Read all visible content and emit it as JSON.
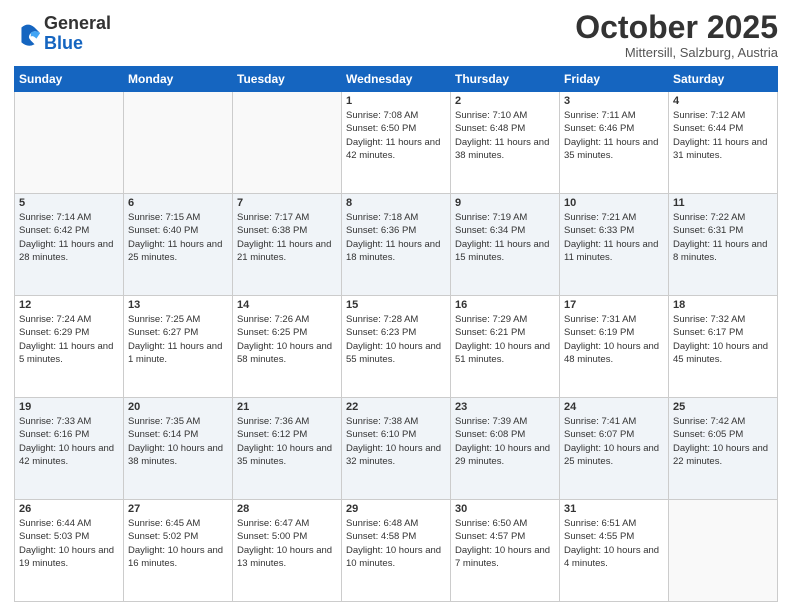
{
  "logo": {
    "general": "General",
    "blue": "Blue"
  },
  "header": {
    "month": "October 2025",
    "location": "Mittersill, Salzburg, Austria"
  },
  "days_of_week": [
    "Sunday",
    "Monday",
    "Tuesday",
    "Wednesday",
    "Thursday",
    "Friday",
    "Saturday"
  ],
  "weeks": [
    [
      {
        "day": "",
        "sunrise": "",
        "sunset": "",
        "daylight": ""
      },
      {
        "day": "",
        "sunrise": "",
        "sunset": "",
        "daylight": ""
      },
      {
        "day": "",
        "sunrise": "",
        "sunset": "",
        "daylight": ""
      },
      {
        "day": "1",
        "sunrise": "Sunrise: 7:08 AM",
        "sunset": "Sunset: 6:50 PM",
        "daylight": "Daylight: 11 hours and 42 minutes."
      },
      {
        "day": "2",
        "sunrise": "Sunrise: 7:10 AM",
        "sunset": "Sunset: 6:48 PM",
        "daylight": "Daylight: 11 hours and 38 minutes."
      },
      {
        "day": "3",
        "sunrise": "Sunrise: 7:11 AM",
        "sunset": "Sunset: 6:46 PM",
        "daylight": "Daylight: 11 hours and 35 minutes."
      },
      {
        "day": "4",
        "sunrise": "Sunrise: 7:12 AM",
        "sunset": "Sunset: 6:44 PM",
        "daylight": "Daylight: 11 hours and 31 minutes."
      }
    ],
    [
      {
        "day": "5",
        "sunrise": "Sunrise: 7:14 AM",
        "sunset": "Sunset: 6:42 PM",
        "daylight": "Daylight: 11 hours and 28 minutes."
      },
      {
        "day": "6",
        "sunrise": "Sunrise: 7:15 AM",
        "sunset": "Sunset: 6:40 PM",
        "daylight": "Daylight: 11 hours and 25 minutes."
      },
      {
        "day": "7",
        "sunrise": "Sunrise: 7:17 AM",
        "sunset": "Sunset: 6:38 PM",
        "daylight": "Daylight: 11 hours and 21 minutes."
      },
      {
        "day": "8",
        "sunrise": "Sunrise: 7:18 AM",
        "sunset": "Sunset: 6:36 PM",
        "daylight": "Daylight: 11 hours and 18 minutes."
      },
      {
        "day": "9",
        "sunrise": "Sunrise: 7:19 AM",
        "sunset": "Sunset: 6:34 PM",
        "daylight": "Daylight: 11 hours and 15 minutes."
      },
      {
        "day": "10",
        "sunrise": "Sunrise: 7:21 AM",
        "sunset": "Sunset: 6:33 PM",
        "daylight": "Daylight: 11 hours and 11 minutes."
      },
      {
        "day": "11",
        "sunrise": "Sunrise: 7:22 AM",
        "sunset": "Sunset: 6:31 PM",
        "daylight": "Daylight: 11 hours and 8 minutes."
      }
    ],
    [
      {
        "day": "12",
        "sunrise": "Sunrise: 7:24 AM",
        "sunset": "Sunset: 6:29 PM",
        "daylight": "Daylight: 11 hours and 5 minutes."
      },
      {
        "day": "13",
        "sunrise": "Sunrise: 7:25 AM",
        "sunset": "Sunset: 6:27 PM",
        "daylight": "Daylight: 11 hours and 1 minute."
      },
      {
        "day": "14",
        "sunrise": "Sunrise: 7:26 AM",
        "sunset": "Sunset: 6:25 PM",
        "daylight": "Daylight: 10 hours and 58 minutes."
      },
      {
        "day": "15",
        "sunrise": "Sunrise: 7:28 AM",
        "sunset": "Sunset: 6:23 PM",
        "daylight": "Daylight: 10 hours and 55 minutes."
      },
      {
        "day": "16",
        "sunrise": "Sunrise: 7:29 AM",
        "sunset": "Sunset: 6:21 PM",
        "daylight": "Daylight: 10 hours and 51 minutes."
      },
      {
        "day": "17",
        "sunrise": "Sunrise: 7:31 AM",
        "sunset": "Sunset: 6:19 PM",
        "daylight": "Daylight: 10 hours and 48 minutes."
      },
      {
        "day": "18",
        "sunrise": "Sunrise: 7:32 AM",
        "sunset": "Sunset: 6:17 PM",
        "daylight": "Daylight: 10 hours and 45 minutes."
      }
    ],
    [
      {
        "day": "19",
        "sunrise": "Sunrise: 7:33 AM",
        "sunset": "Sunset: 6:16 PM",
        "daylight": "Daylight: 10 hours and 42 minutes."
      },
      {
        "day": "20",
        "sunrise": "Sunrise: 7:35 AM",
        "sunset": "Sunset: 6:14 PM",
        "daylight": "Daylight: 10 hours and 38 minutes."
      },
      {
        "day": "21",
        "sunrise": "Sunrise: 7:36 AM",
        "sunset": "Sunset: 6:12 PM",
        "daylight": "Daylight: 10 hours and 35 minutes."
      },
      {
        "day": "22",
        "sunrise": "Sunrise: 7:38 AM",
        "sunset": "Sunset: 6:10 PM",
        "daylight": "Daylight: 10 hours and 32 minutes."
      },
      {
        "day": "23",
        "sunrise": "Sunrise: 7:39 AM",
        "sunset": "Sunset: 6:08 PM",
        "daylight": "Daylight: 10 hours and 29 minutes."
      },
      {
        "day": "24",
        "sunrise": "Sunrise: 7:41 AM",
        "sunset": "Sunset: 6:07 PM",
        "daylight": "Daylight: 10 hours and 25 minutes."
      },
      {
        "day": "25",
        "sunrise": "Sunrise: 7:42 AM",
        "sunset": "Sunset: 6:05 PM",
        "daylight": "Daylight: 10 hours and 22 minutes."
      }
    ],
    [
      {
        "day": "26",
        "sunrise": "Sunrise: 6:44 AM",
        "sunset": "Sunset: 5:03 PM",
        "daylight": "Daylight: 10 hours and 19 minutes."
      },
      {
        "day": "27",
        "sunrise": "Sunrise: 6:45 AM",
        "sunset": "Sunset: 5:02 PM",
        "daylight": "Daylight: 10 hours and 16 minutes."
      },
      {
        "day": "28",
        "sunrise": "Sunrise: 6:47 AM",
        "sunset": "Sunset: 5:00 PM",
        "daylight": "Daylight: 10 hours and 13 minutes."
      },
      {
        "day": "29",
        "sunrise": "Sunrise: 6:48 AM",
        "sunset": "Sunset: 4:58 PM",
        "daylight": "Daylight: 10 hours and 10 minutes."
      },
      {
        "day": "30",
        "sunrise": "Sunrise: 6:50 AM",
        "sunset": "Sunset: 4:57 PM",
        "daylight": "Daylight: 10 hours and 7 minutes."
      },
      {
        "day": "31",
        "sunrise": "Sunrise: 6:51 AM",
        "sunset": "Sunset: 4:55 PM",
        "daylight": "Daylight: 10 hours and 4 minutes."
      },
      {
        "day": "",
        "sunrise": "",
        "sunset": "",
        "daylight": ""
      }
    ]
  ]
}
